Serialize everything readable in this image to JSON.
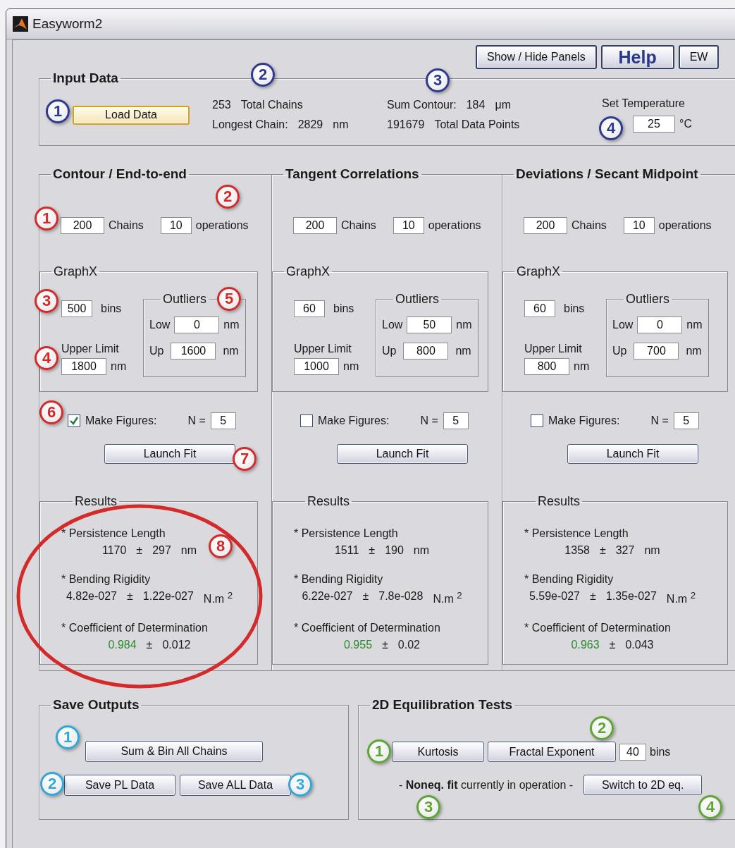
{
  "window": {
    "title": "Easyworm2"
  },
  "top_buttons": [
    {
      "label": "Show / Hide Panels",
      "kind": "normal"
    },
    {
      "label": "Help",
      "kind": "help"
    },
    {
      "label": "EW",
      "kind": "normal"
    }
  ],
  "input_data": {
    "title": "Input Data",
    "load_button": {
      "label": "Load Data",
      "default": true
    },
    "stats": [
      {
        "lines": [
          [
            "253",
            "Total Chains"
          ],
          [
            "Longest Chain:",
            "2829",
            "nm"
          ]
        ]
      },
      {
        "lines": [
          [
            "Sum Contour:",
            "184",
            "μm"
          ],
          [
            "191679",
            "Total Data Points"
          ]
        ]
      }
    ],
    "temperature": {
      "label": "Set Temperature",
      "value": "25",
      "unit": "°C"
    }
  },
  "columns": [
    {
      "title": "Contour / End-to-end",
      "chains": "200",
      "chains_label": "Chains",
      "operations": "10",
      "operations_label": "operations",
      "graphx": {
        "title": "GraphX",
        "bins": "500",
        "bins_label": "bins",
        "upper_limit_label": "Upper Limit",
        "upper_limit": "1800",
        "upper_unit": "nm",
        "outliers": {
          "title": "Outliers",
          "low_label": "Low",
          "low": "0",
          "low_unit": "nm",
          "up_label": "Up",
          "up": "1600",
          "up_unit": "nm"
        }
      },
      "make_figures": {
        "label": "Make Figures:",
        "checked": true,
        "n_label": "N =",
        "n": "5"
      },
      "launch_button": "Launch Fit",
      "results": {
        "title": "Results",
        "items": [
          {
            "title": "* Persistence Length",
            "value": "1170",
            "sign": "±",
            "error": "297",
            "unit": "nm",
            "highlight": false
          },
          {
            "title": "* Bending Rigidity",
            "value": "4.82e-027",
            "sign": "±",
            "error": "1.22e-027",
            "unit": "N.m $^{2}$",
            "highlight": false
          },
          {
            "title": "* Coefficient of Determination",
            "value": "0.984",
            "sign": "±",
            "error": "0.012",
            "highlight": true
          }
        ]
      }
    },
    {
      "title": "Tangent Correlations",
      "chains": "200",
      "chains_label": "Chains",
      "operations": "10",
      "operations_label": "operations",
      "graphx": {
        "title": "GraphX",
        "bins": "60",
        "bins_label": "bins",
        "upper_limit_label": "Upper Limit",
        "upper_limit": "1000",
        "upper_unit": "nm",
        "outliers": {
          "title": "Outliers",
          "low_label": "Low",
          "low": "50",
          "low_unit": "nm",
          "up_label": "Up",
          "up": "800",
          "up_unit": "nm"
        }
      },
      "make_figures": {
        "label": "Make Figures:",
        "checked": false,
        "n_label": "N =",
        "n": "5"
      },
      "launch_button": "Launch Fit",
      "results": {
        "title": "Results",
        "items": [
          {
            "title": "* Persistence Length",
            "value": "1511",
            "sign": "±",
            "error": "190",
            "unit": "nm",
            "highlight": false
          },
          {
            "title": "* Bending Rigidity",
            "value": "6.22e-027",
            "sign": "±",
            "error": "7.8e-028",
            "unit": "N.m $^{2}$",
            "highlight": false
          },
          {
            "title": "* Coefficient of Determination",
            "value": "0.955",
            "sign": "±",
            "error": "0.02",
            "highlight": true
          }
        ]
      }
    },
    {
      "title": "Deviations / Secant Midpoint",
      "chains": "200",
      "chains_label": "Chains",
      "operations": "10",
      "operations_label": "operations",
      "graphx": {
        "title": "GraphX",
        "bins": "60",
        "bins_label": "bins",
        "upper_limit_label": "Upper Limit",
        "upper_limit": "800",
        "upper_unit": "nm",
        "outliers": {
          "title": "Outliers",
          "low_label": "Low",
          "low": "0",
          "low_unit": "nm",
          "up_label": "Up",
          "up": "700",
          "up_unit": "nm"
        }
      },
      "make_figures": {
        "label": "Make Figures:",
        "checked": false,
        "n_label": "N =",
        "n": "5"
      },
      "launch_button": "Launch Fit",
      "results": {
        "title": "Results",
        "items": [
          {
            "title": "* Persistence Length",
            "value": "1358",
            "sign": "±",
            "error": "327",
            "unit": "nm",
            "highlight": false
          },
          {
            "title": "* Bending Rigidity",
            "value": "5.59e-027",
            "sign": "±",
            "error": "1.35e-027",
            "unit": "N.m $^{2}$",
            "highlight": false
          },
          {
            "title": "* Coefficient of Determination",
            "value": "0.963",
            "sign": "±",
            "error": "0.043",
            "highlight": true
          }
        ]
      }
    }
  ],
  "save_outputs": {
    "title": "Save Outputs",
    "buttons": [
      "Sum & Bin All Chains",
      "Save PL Data",
      "Save ALL Data"
    ]
  },
  "equilibration": {
    "title": "2D Equilibration Tests",
    "kurtosis_button": "Kurtosis",
    "fractal_button": "Fractal Exponent",
    "bins": "40",
    "bins_label": "bins",
    "status": "- **Noneq. fit** currently in operation -",
    "switch_button": "Switch to 2D eq."
  },
  "callouts": [
    {
      "label": "1",
      "color": "#2d3a8f"
    },
    {
      "label": "2",
      "color": "#2d3a8f"
    },
    {
      "label": "3",
      "color": "#2d3a8f"
    },
    {
      "label": "4",
      "color": "#2d3a8f"
    },
    {
      "label": "1",
      "color": "#d42a2a"
    },
    {
      "label": "2",
      "color": "#d42a2a"
    },
    {
      "label": "3",
      "color": "#d42a2a"
    },
    {
      "label": "4",
      "color": "#d42a2a"
    },
    {
      "label": "5",
      "color": "#d42a2a"
    },
    {
      "label": "6",
      "color": "#d42a2a"
    },
    {
      "label": "7",
      "color": "#d42a2a"
    },
    {
      "label": "8",
      "color": "#d42a2a"
    },
    {
      "label": "1",
      "color": "#2fa8d6"
    },
    {
      "label": "2",
      "color": "#2fa8d6"
    },
    {
      "label": "3",
      "color": "#2fa8d6"
    },
    {
      "label": "1",
      "color": "#5fa535"
    },
    {
      "label": "2",
      "color": "#5fa535"
    },
    {
      "label": "3",
      "color": "#5fa535"
    },
    {
      "label": "4",
      "color": "#5fa535"
    }
  ],
  "highlight_ellipse": {
    "color": "#d42a2a"
  }
}
